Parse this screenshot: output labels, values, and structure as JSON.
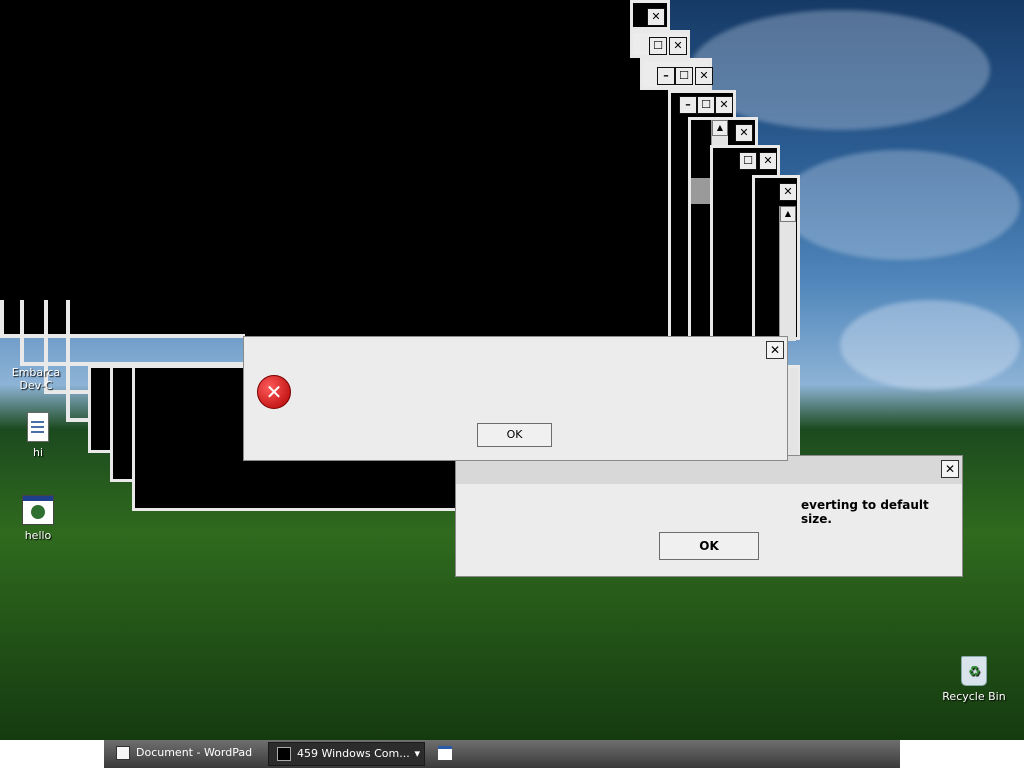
{
  "desktop": {
    "icons": [
      {
        "label_line1": "Embarca",
        "label_line2": "Dev-C",
        "icon": "devcpp-icon"
      },
      {
        "label": "hi",
        "icon": "notepad-document-icon"
      },
      {
        "label": "hello",
        "icon": "executable-window-icon"
      },
      {
        "label": "Recycle Bin",
        "icon": "recycle-bin-icon"
      }
    ]
  },
  "stacked_windows": {
    "title_buttons": {
      "minimize": "–",
      "maximize": "☐",
      "close": "✕"
    },
    "scroll_arrows": {
      "up": "▲",
      "down": "▼"
    }
  },
  "error_dialog": {
    "icon": "error-icon",
    "message": "",
    "ok_label": "OK",
    "close_label": "✕"
  },
  "resize_dialog": {
    "message": "everting to default size.",
    "ok_label": "OK",
    "close_label": "✕"
  },
  "taskbar": {
    "items": [
      {
        "label": "Document - WordPad",
        "icon": "wordpad-icon"
      },
      {
        "label": "459 Windows Com...",
        "icon": "cmd-icon",
        "dropdown": "▾"
      },
      {
        "label": "",
        "icon": "window-icon"
      }
    ]
  },
  "colors": {
    "error_red": "#cc1111",
    "taskbar_dark": "#3a3a3a",
    "dialog_bg": "#ececec"
  }
}
